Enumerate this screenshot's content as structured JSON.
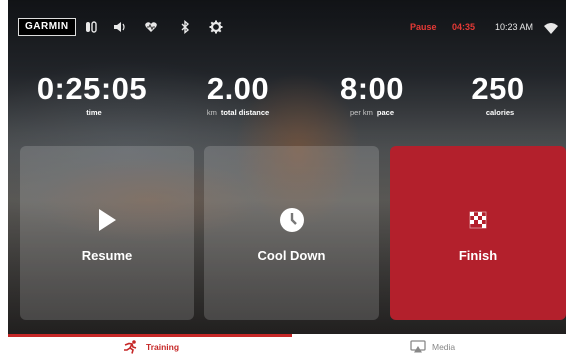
{
  "status": {
    "brand": "GARMIN",
    "icons": [
      "walk-icon",
      "volume-icon",
      "heart-icon",
      "bluetooth-icon",
      "gear-icon"
    ],
    "pause_label": "Pause",
    "timer": "04:35",
    "time": "10:23 AM",
    "wifi_icon": "wifi-icon"
  },
  "metrics": [
    {
      "value": "0:25:05",
      "unit": "",
      "label": "time"
    },
    {
      "value": "2.00",
      "unit": "km",
      "label": "total distance"
    },
    {
      "value": "8:00",
      "unit": "per km",
      "label": "pace"
    },
    {
      "value": "250",
      "unit": "",
      "label": "calories"
    }
  ],
  "actions": {
    "resume": {
      "label": "Resume",
      "icon": "play-icon"
    },
    "cooldown": {
      "label": "Cool Down",
      "icon": "clock-icon"
    },
    "finish": {
      "label": "Finish",
      "icon": "checkered-flag-icon"
    }
  },
  "nav": {
    "training": {
      "label": "Training",
      "icon": "runner-icon"
    },
    "media": {
      "label": "Media",
      "icon": "airplay-icon"
    }
  },
  "colors": {
    "accent": "#c62828",
    "finish_tile": "#b3202c"
  }
}
